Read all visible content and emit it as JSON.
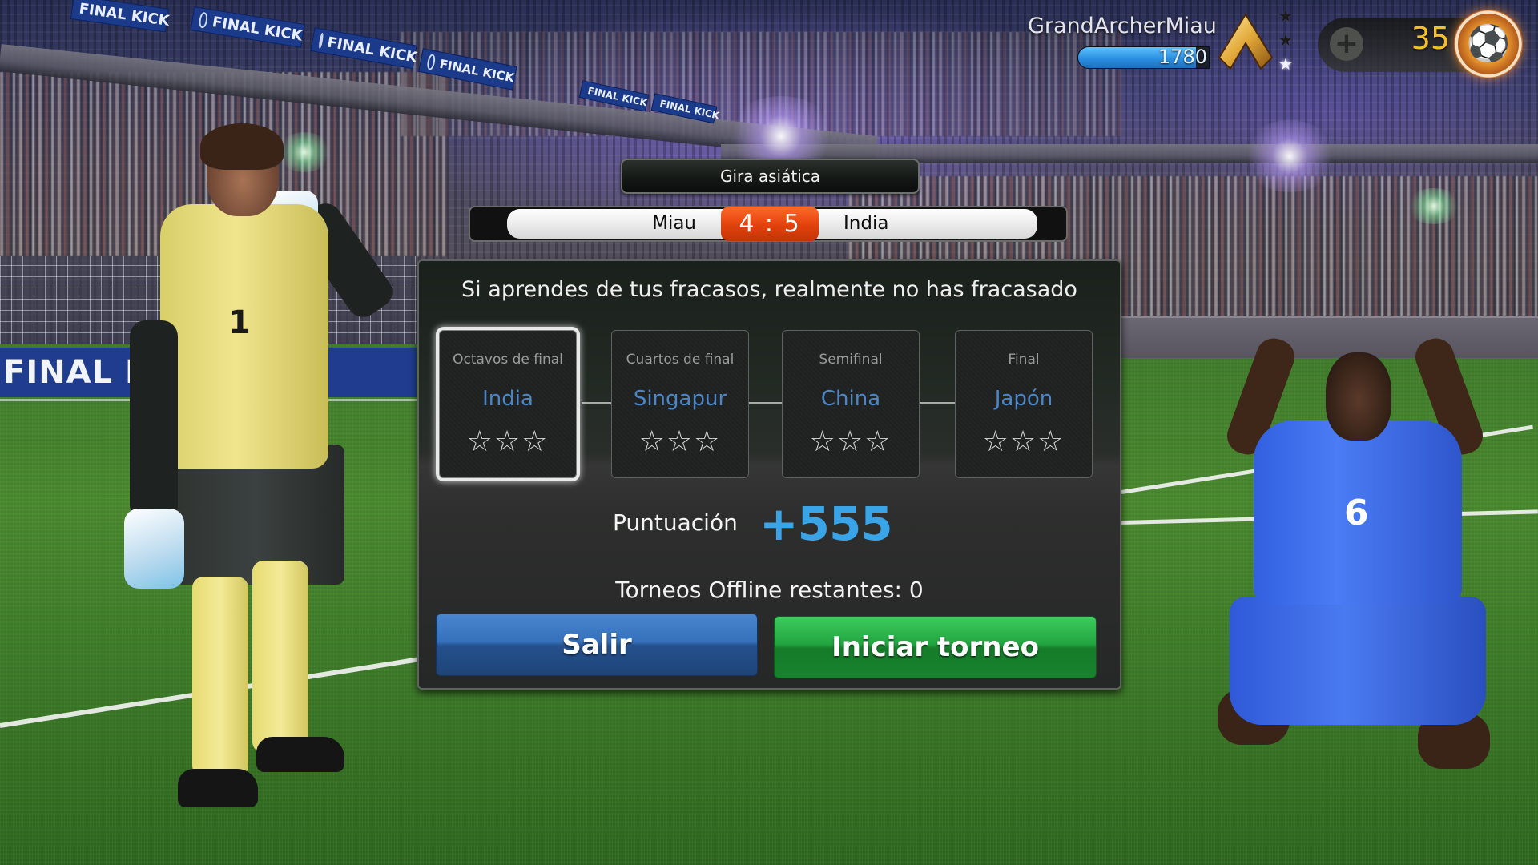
{
  "hud": {
    "username": "GrandArcherMiau",
    "xp_value": "1780",
    "xp_progress_percent": 90,
    "rank_icon": "chevron-rank-icon",
    "rank_stars": [
      {
        "filled": false
      },
      {
        "filled": false
      },
      {
        "filled": true
      }
    ],
    "add_currency_icon": "plus-icon",
    "currency_amount": "35",
    "currency_icon": "soccer-ball-coin-icon"
  },
  "tournament": {
    "title": "Gira asiática",
    "match": {
      "home_team": "Miau",
      "away_team": "India",
      "score": "4 : 5"
    }
  },
  "panel": {
    "quote": "Si aprendes de tus fracasos, realmente no has fracasado",
    "stages": [
      {
        "round": "Octavos de final",
        "opponent": "India",
        "stars": "☆☆☆",
        "stars_earned": 0,
        "current": true
      },
      {
        "round": "Cuartos de final",
        "opponent": "Singapur",
        "stars": "☆☆☆",
        "stars_earned": 0,
        "current": false
      },
      {
        "round": "Semifinal",
        "opponent": "China",
        "stars": "☆☆☆",
        "stars_earned": 0,
        "current": false
      },
      {
        "round": "Final",
        "opponent": "Japón",
        "stars": "☆☆☆",
        "stars_earned": 0,
        "current": false
      }
    ],
    "score_label": "Puntuación",
    "score_value": "+555",
    "offline_remaining": "Torneos Offline restantes: 0",
    "buttons": {
      "exit": "Salir",
      "start": "Iniciar torneo"
    }
  },
  "scene": {
    "banner_text": "FINAL KICK",
    "goalkeeper_number": "1",
    "striker_number": "6"
  },
  "colors": {
    "opponent_text": "#4a86c8",
    "score_value": "#3aa4e8",
    "score_box": "#e2410c",
    "exit_button": "#3570ba",
    "start_button": "#22a540",
    "currency": "#f4c02a"
  }
}
